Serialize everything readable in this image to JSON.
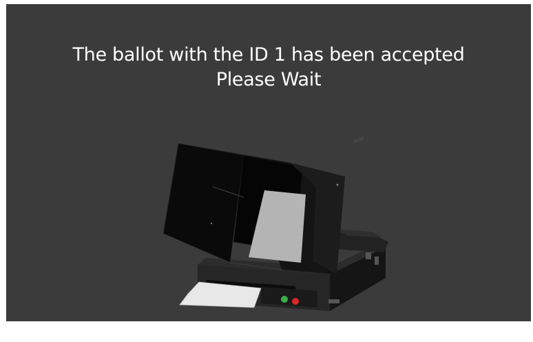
{
  "status": {
    "line1": "The ballot with the ID 1 has been accepted",
    "line2": "Please Wait"
  },
  "illustration": {
    "subject": "ballot-scanner-machine",
    "paper_color": "#e8e8e8",
    "indicator_green": "#3fae49",
    "indicator_red": "#d9262b"
  }
}
